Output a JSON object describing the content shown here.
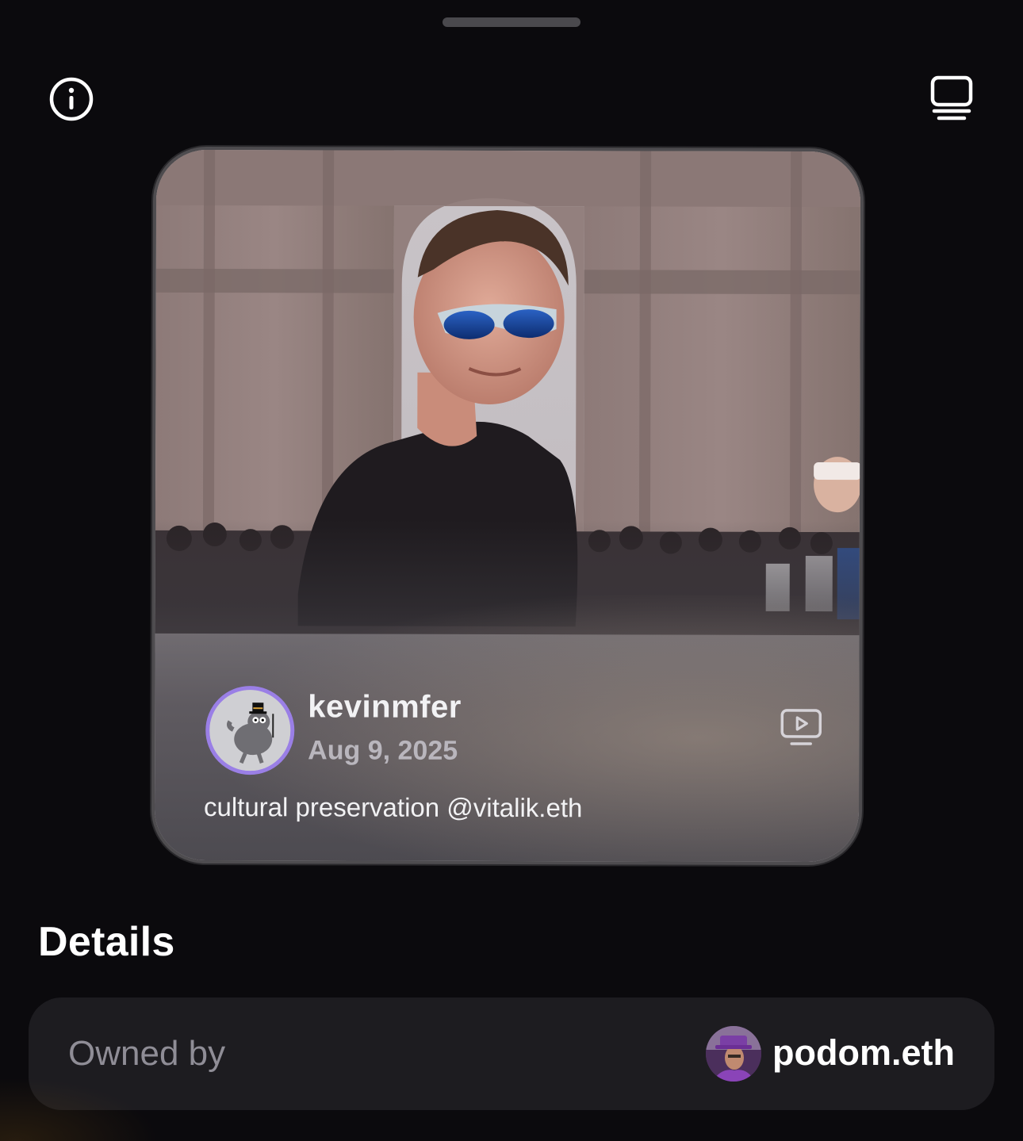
{
  "header": {
    "info_icon": "info-circle-icon",
    "display_icon": "monitor-stack-icon"
  },
  "post": {
    "author": "kevinmfer",
    "date": "Aug 9, 2025",
    "caption": "cultural preservation @vitalik.eth",
    "media_icon": "video-play-icon",
    "accent_color": "#9a7fe6"
  },
  "details": {
    "title": "Details",
    "owned_by_label": "Owned by",
    "owner_name": "podom.eth"
  }
}
